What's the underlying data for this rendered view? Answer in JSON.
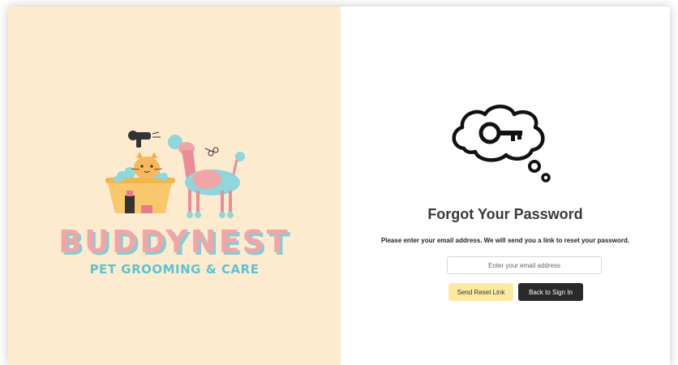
{
  "brand": {
    "name": "BUDDYNEST",
    "tagline": "PET GROOMING & CARE"
  },
  "forgot": {
    "title": "Forgot Your Password",
    "description": "Please enter your email address. We will send you a link to reset your password.",
    "email_placeholder": "Enter your email address",
    "email_value": "",
    "send_button": "Send Reset Link",
    "back_button": "Back to Sign In"
  },
  "icons": {
    "logo": "pet-grooming-logo-icon",
    "thought": "key-thought-bubble-icon"
  },
  "colors": {
    "left_panel_bg": "#fdebd0",
    "brand_pink": "#f0a6a6",
    "brand_teal": "#5bc4cf",
    "send_button_bg": "#fbeaa0",
    "back_button_bg": "#2a2a2a"
  }
}
